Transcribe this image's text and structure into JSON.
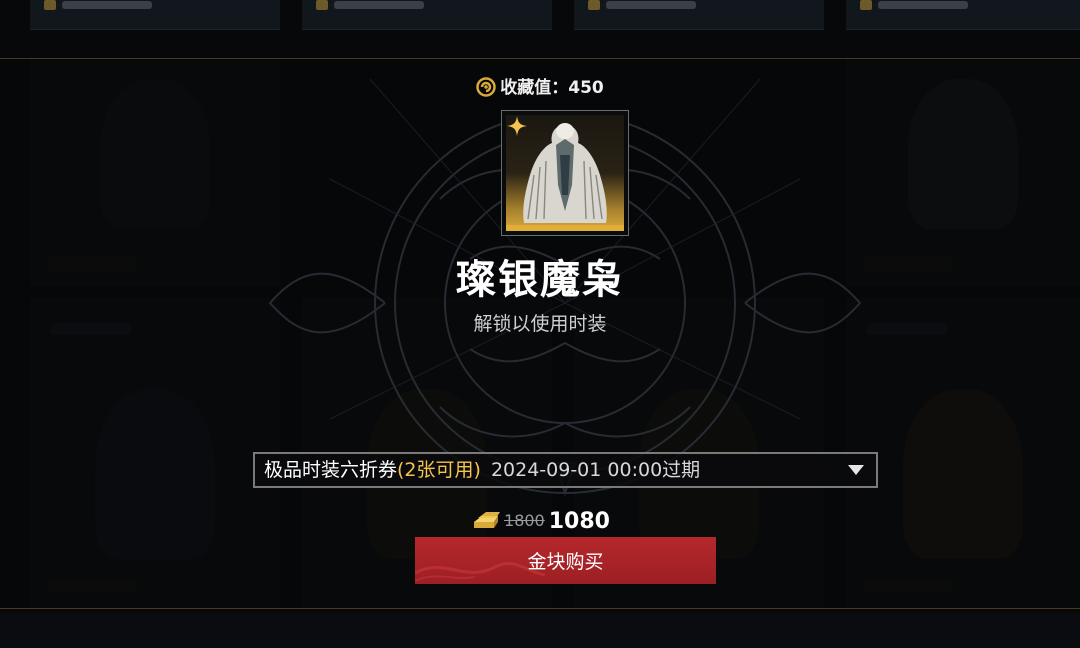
{
  "collection": {
    "label": "收藏值：",
    "value": "450"
  },
  "item": {
    "name": "璨银魔枭",
    "subtitle": "解锁以使用时装"
  },
  "coupon": {
    "name": "极品时装六折券",
    "available": "(2张可用)",
    "expiry": "2024-09-01 00:00过期"
  },
  "price": {
    "original": "1800",
    "current": "1080",
    "currency_icon": "gold-bar-icon"
  },
  "buy_button": {
    "label": "金块购买"
  },
  "colors": {
    "accent_gold": "#f3c54d",
    "buy_red": "#b5282c",
    "frame_border": "#4a3a22"
  }
}
